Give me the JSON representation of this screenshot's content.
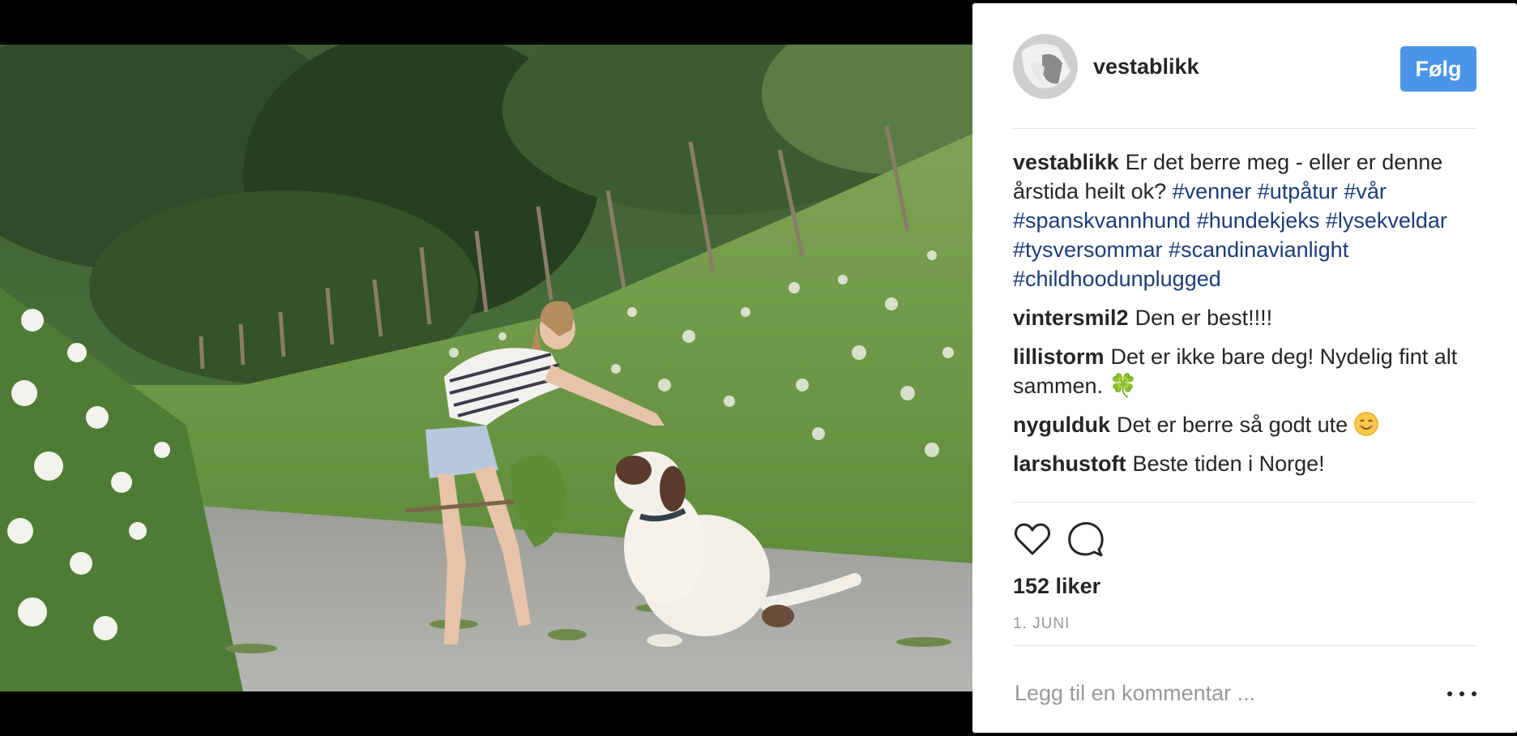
{
  "post": {
    "username": "vestablikk",
    "follow_label": "Følg",
    "caption_text": "Er det berre meg - eller er denne årstida heilt ok?",
    "hashtags": [
      "#venner",
      "#utpåtur",
      "#vår",
      "#spanskvannhund",
      "#hundekjeks",
      "#lysekveldar",
      "#tysversommar",
      "#scandinavianlight",
      "#childhoodunplugged"
    ],
    "likes": "152 liker",
    "date": "1. JUNI"
  },
  "comments": [
    {
      "user": "vintersmil2",
      "text": "Den er best!!!!"
    },
    {
      "user": "lillistorm",
      "text": "Det er ikke bare deg! Nydelig fint alt sammen.",
      "emoji": "🍀"
    },
    {
      "user": "nygulduk",
      "text": "Det er berre så godt ute",
      "emoji": "smiling-face"
    },
    {
      "user": "larshustoft",
      "text": "Beste tiden i Norge!"
    },
    {
      "user": "…",
      "text": "…",
      "partial": true
    }
  ],
  "comment_box": {
    "placeholder": "Legg til en kommentar ..."
  },
  "icons": {
    "like": "heart-icon",
    "comment": "speech-bubble-icon",
    "more": "more-options-icon"
  },
  "colors": {
    "follow_button": "#4a95e8",
    "hashtag": "#1c3d78",
    "text": "#262626",
    "muted": "#999999"
  }
}
